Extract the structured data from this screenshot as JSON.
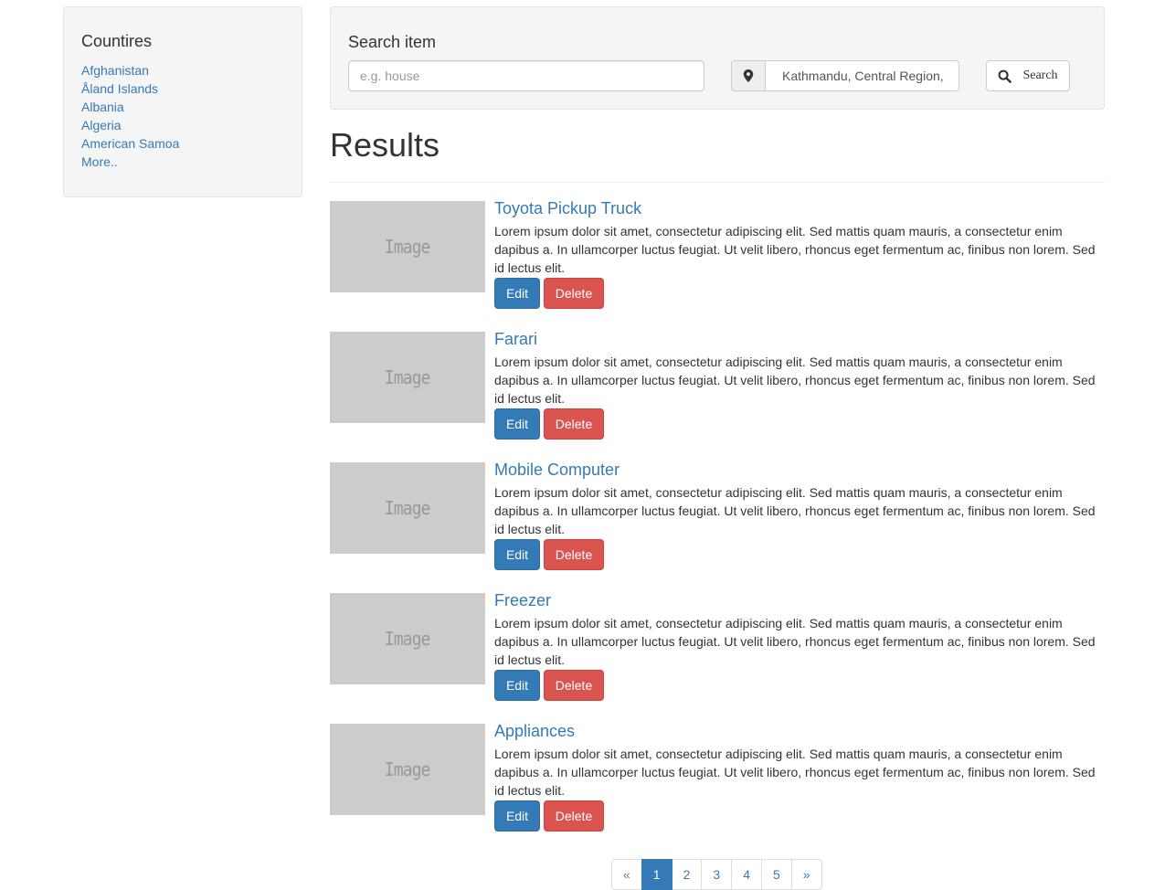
{
  "sidebar": {
    "title": "Countires",
    "countries": [
      "Afghanistan",
      "Åland Islands",
      "Albania",
      "Algeria",
      "American Samoa",
      "More.."
    ]
  },
  "search": {
    "title": "Search item",
    "placeholder": "e.g. house",
    "location_value": "Kathmandu, Central Region, Nepal",
    "location_icon": "map-marker-icon",
    "button_label": "Search",
    "button_icon": "search-icon"
  },
  "results": {
    "title": "Results",
    "image_label": "Image",
    "edit_label": "Edit",
    "delete_label": "Delete",
    "items": [
      {
        "title": "Toyota Pickup Truck",
        "description": "Lorem ipsum dolor sit amet, consectetur adipiscing elit. Sed mattis quam mauris, a consectetur enim dapibus a. In ullamcorper luctus feugiat. Ut velit libero, rhoncus eget fermentum ac, finibus non lorem. Sed id lectus elit."
      },
      {
        "title": "Farari",
        "description": "Lorem ipsum dolor sit amet, consectetur adipiscing elit. Sed mattis quam mauris, a consectetur enim dapibus a. In ullamcorper luctus feugiat. Ut velit libero, rhoncus eget fermentum ac, finibus non lorem. Sed id lectus elit."
      },
      {
        "title": "Mobile Computer",
        "description": "Lorem ipsum dolor sit amet, consectetur adipiscing elit. Sed mattis quam mauris, a consectetur enim dapibus a. In ullamcorper luctus feugiat. Ut velit libero, rhoncus eget fermentum ac, finibus non lorem. Sed id lectus elit."
      },
      {
        "title": "Freezer",
        "description": "Lorem ipsum dolor sit amet, consectetur adipiscing elit. Sed mattis quam mauris, a consectetur enim dapibus a. In ullamcorper luctus feugiat. Ut velit libero, rhoncus eget fermentum ac, finibus non lorem. Sed id lectus elit."
      },
      {
        "title": "Appliances",
        "description": "Lorem ipsum dolor sit amet, consectetur adipiscing elit. Sed mattis quam mauris, a consectetur enim dapibus a. In ullamcorper luctus feugiat. Ut velit libero, rhoncus eget fermentum ac, finibus non lorem. Sed id lectus elit."
      }
    ]
  },
  "pagination": {
    "prev": "«",
    "pages": [
      "1",
      "2",
      "3",
      "4",
      "5"
    ],
    "active": "1",
    "next": "»"
  },
  "colors": {
    "primary": "#337ab7",
    "danger": "#d9534f",
    "well": "#f5f5f5",
    "placeholder_image": "#cccccc"
  }
}
